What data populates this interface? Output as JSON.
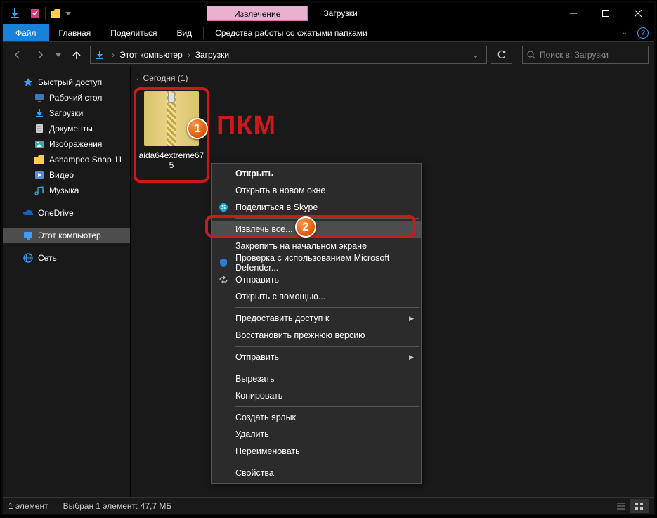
{
  "titlebar": {
    "context_tab": "Извлечение",
    "title": "Загрузки"
  },
  "window_controls": {
    "minimize": "minimize",
    "maximize": "maximize",
    "close": "close"
  },
  "ribbon": {
    "file": "Файл",
    "home": "Главная",
    "share": "Поделиться",
    "view": "Вид",
    "compressed": "Средства работы со сжатыми папками"
  },
  "address": {
    "root": "Этот компьютер",
    "folder": "Загрузки"
  },
  "search": {
    "placeholder": "Поиск в: Загрузки"
  },
  "sidebar": {
    "quick_access": "Быстрый доступ",
    "desktop": "Рабочий стол",
    "downloads": "Загрузки",
    "documents": "Документы",
    "pictures": "Изображения",
    "ashampoo": "Ashampoo Snap 11",
    "videos": "Видео",
    "music": "Музыка",
    "onedrive": "OneDrive",
    "this_pc": "Этот компьютер",
    "network": "Сеть"
  },
  "content": {
    "group_today": "Сегодня (1)",
    "file_name": "aida64extreme675"
  },
  "annotation": {
    "label_1": "1",
    "label_2": "2",
    "pkm": "ПКМ"
  },
  "context_menu": {
    "open": "Открыть",
    "open_new_window": "Открыть в новом окне",
    "skype": "Поделиться в Skype",
    "extract_all": "Извлечь все...",
    "pin_start": "Закрепить на начальном экране",
    "defender": "Проверка с использованием Microsoft Defender...",
    "share": "Отправить",
    "open_with": "Открыть с помощью...",
    "give_access": "Предоставить доступ к",
    "restore_prev": "Восстановить прежнюю версию",
    "send_to": "Отправить",
    "cut": "Вырезать",
    "copy": "Копировать",
    "create_shortcut": "Создать ярлык",
    "delete": "Удалить",
    "rename": "Переименовать",
    "properties": "Свойства"
  },
  "statusbar": {
    "count": "1 элемент",
    "selection": "Выбран 1 элемент: 47,7 МБ"
  }
}
